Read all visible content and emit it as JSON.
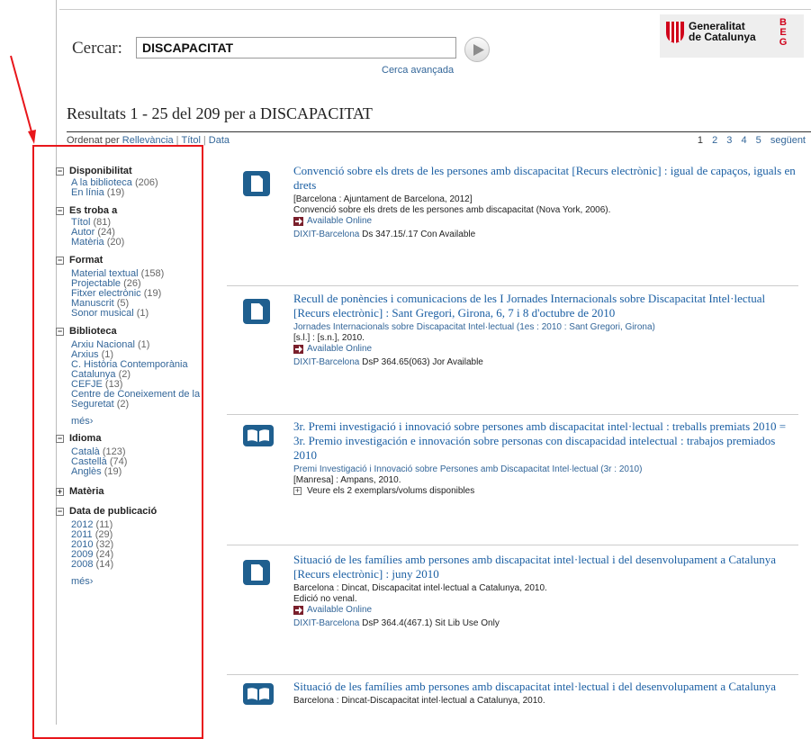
{
  "search": {
    "label": "Cercar:",
    "value": "DISCAPACITAT",
    "advanced_link": "Cerca avançada"
  },
  "logo": {
    "line1": "Generalitat",
    "line2": "de Catalunya",
    "badge": [
      "B",
      "E",
      "G"
    ]
  },
  "results_heading": "Resultats 1 - 25 del 209 per a DISCAPACITAT",
  "sort": {
    "label": "Ordenat per",
    "options": [
      "Rellevància",
      "Títol",
      "Data"
    ]
  },
  "pager": {
    "pages": [
      "1",
      "2",
      "3",
      "4",
      "5"
    ],
    "next": "següent"
  },
  "facets": [
    {
      "title": "Disponibilitat",
      "expanded": true,
      "items": [
        {
          "label": "A la biblioteca",
          "count": "(206)"
        },
        {
          "label": "En línia",
          "count": "(19)"
        }
      ]
    },
    {
      "title": "Es troba a",
      "expanded": true,
      "items": [
        {
          "label": "Títol",
          "count": "(81)"
        },
        {
          "label": "Autor",
          "count": "(24)"
        },
        {
          "label": "Matèria",
          "count": "(20)"
        }
      ]
    },
    {
      "title": "Format",
      "expanded": true,
      "items": [
        {
          "label": "Material textual",
          "count": "(158)"
        },
        {
          "label": "Projectable",
          "count": "(26)"
        },
        {
          "label": "Fitxer electrònic",
          "count": "(19)"
        },
        {
          "label": "Manuscrit",
          "count": "(5)"
        },
        {
          "label": "Sonor musical",
          "count": "(1)"
        }
      ]
    },
    {
      "title": "Biblioteca",
      "expanded": true,
      "more": "més›",
      "items": [
        {
          "label": "Arxiu Nacional",
          "count": "(1)"
        },
        {
          "label": "Arxius",
          "count": "(1)"
        },
        {
          "label": "C. Història Contemporània Catalunya",
          "count": "(2)"
        },
        {
          "label": "CEFJE",
          "count": "(13)"
        },
        {
          "label": "Centre de Coneixement de la Seguretat",
          "count": "(2)"
        }
      ]
    },
    {
      "title": "Idioma",
      "expanded": true,
      "items": [
        {
          "label": "Català",
          "count": "(123)"
        },
        {
          "label": "Castellà",
          "count": "(74)"
        },
        {
          "label": "Anglès",
          "count": "(19)"
        }
      ]
    },
    {
      "title": "Matèria",
      "expanded": false,
      "items": []
    },
    {
      "title": "Data de publicació",
      "expanded": true,
      "more": "més›",
      "items": [
        {
          "label": "2012",
          "count": "(11)"
        },
        {
          "label": "2011",
          "count": "(29)"
        },
        {
          "label": "2010",
          "count": "(32)"
        },
        {
          "label": "2009",
          "count": "(24)"
        },
        {
          "label": "2008",
          "count": "(14)"
        }
      ]
    }
  ],
  "records": [
    {
      "icon": "document-icon",
      "title": "Convenció sobre els drets de les persones amb discapacitat [Recurs electrònic] : igual de capaços, iguals en drets",
      "lines": [
        "[Barcelona : Ajuntament de Barcelona, 2012]",
        "Convenció sobre els drets de les persones amb discapacitat (Nova York, 2006)."
      ],
      "available_online": "Available Online",
      "holding_library": "DIXIT-Barcelona",
      "holding_text": " Ds 347.15/.17 Con Available"
    },
    {
      "icon": "document-icon",
      "title": "Recull de ponències i comunicacions de les I Jornades Internacionals sobre Discapacitat Intel·lectual [Recurs electrònic] : Sant Gregori, Girona, 6, 7 i 8 d'octubre de 2010",
      "author": "Jornades Internacionals sobre Discapacitat Intel·lectual (1es : 2010 : Sant Gregori, Girona)",
      "lines": [
        "[s.l.] : [s.n.], 2010."
      ],
      "available_online": "Available Online",
      "holding_library": "DIXIT-Barcelona",
      "holding_text": " DsP 364.65(063) Jor Available"
    },
    {
      "icon": "book-icon",
      "title": "3r. Premi investigació i innovació sobre persones amb discapacitat intel·lectual : treballs premiats 2010 = 3r. Premio investigación e innovación sobre personas con discapacidad intelectual : trabajos premiados 2010",
      "author": "Premi Investigació i Innovació sobre Persones amb Discapacitat Intel·lectual (3r : 2010)",
      "lines": [
        "[Manresa] : Ampans, 2010."
      ],
      "expand": "Veure els 2 exemplars/volums disponibles"
    },
    {
      "icon": "document-icon",
      "title": "Situació de les famílies amb persones amb discapacitat intel·lectual i del desenvolupament a Catalunya [Recurs electrònic] : juny 2010",
      "lines": [
        "Barcelona : Dincat, Discapacitat intel·lectual a Catalunya, 2010.",
        "Edició no venal."
      ],
      "available_online": "Available Online",
      "holding_library": "DIXIT-Barcelona",
      "holding_text": " DsP 364.4(467.1) Sit Lib Use Only"
    },
    {
      "icon": "book-icon",
      "title": "Situació de les famílies amb persones amb discapacitat intel·lectual i del desenvolupament a Catalunya",
      "lines": [
        "Barcelona : Dincat-Discapacitat intel·lectual a Catalunya, 2010."
      ]
    }
  ]
}
